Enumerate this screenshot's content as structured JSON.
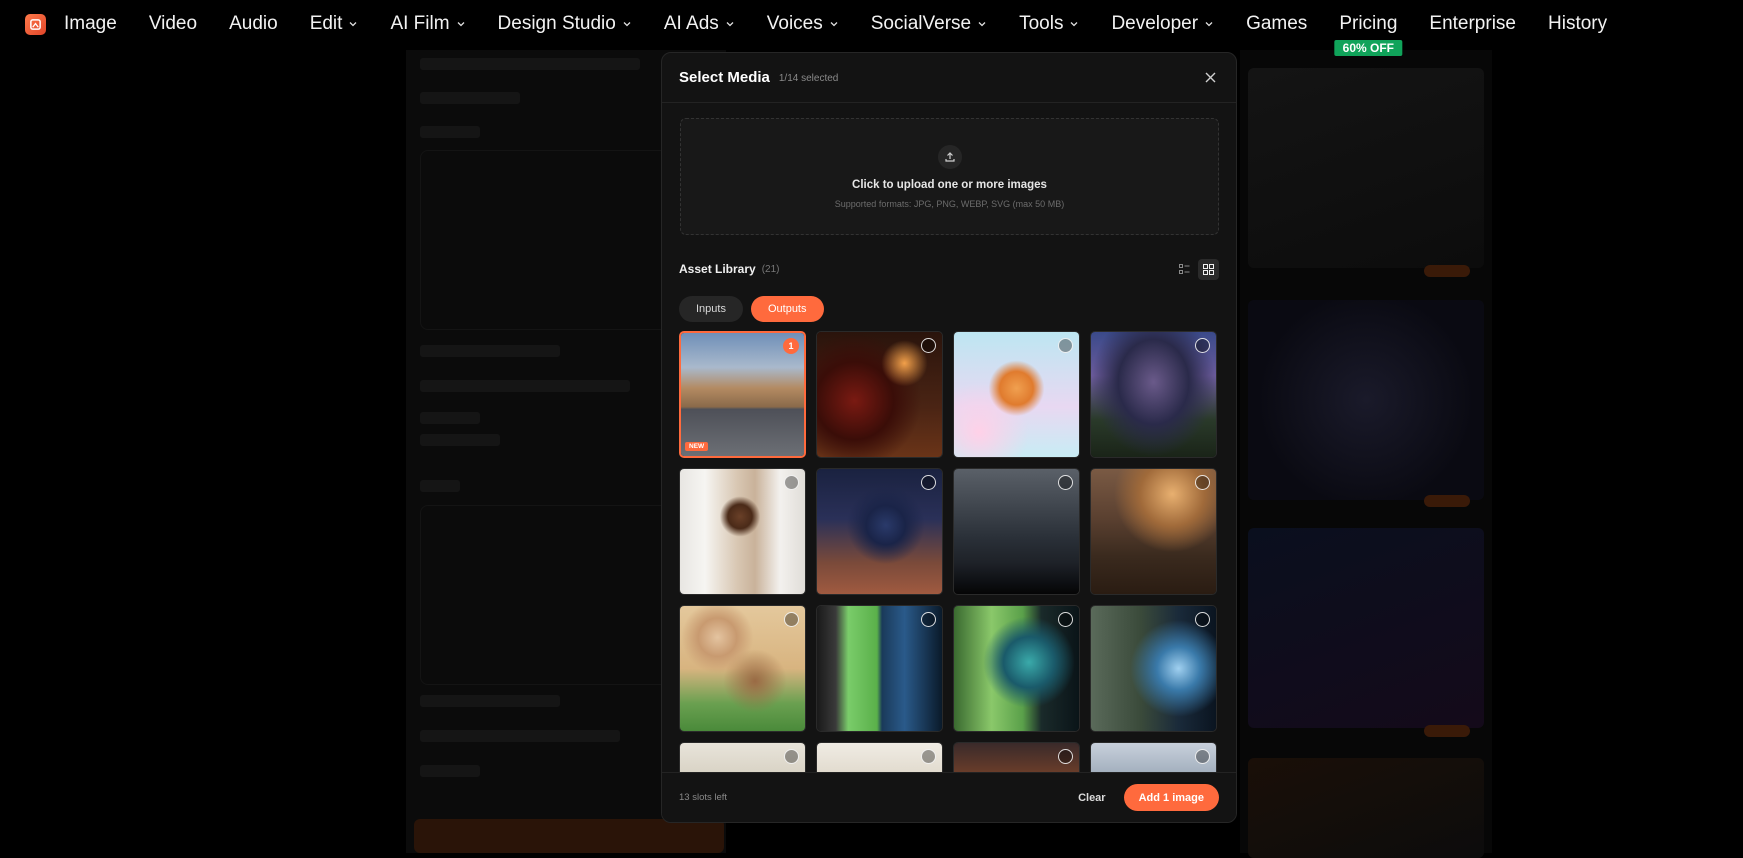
{
  "nav": {
    "items": [
      {
        "label": "Image",
        "dropdown": false
      },
      {
        "label": "Video",
        "dropdown": false
      },
      {
        "label": "Audio",
        "dropdown": false
      },
      {
        "label": "Edit",
        "dropdown": true
      },
      {
        "label": "AI Film",
        "dropdown": true
      },
      {
        "label": "Design Studio",
        "dropdown": true
      },
      {
        "label": "AI Ads",
        "dropdown": true
      },
      {
        "label": "Voices",
        "dropdown": true
      },
      {
        "label": "SocialVerse",
        "dropdown": true
      },
      {
        "label": "Tools",
        "dropdown": true
      },
      {
        "label": "Developer",
        "dropdown": true
      },
      {
        "label": "Games",
        "dropdown": false
      },
      {
        "label": "Pricing",
        "dropdown": false,
        "badge": "60% OFF"
      },
      {
        "label": "Enterprise",
        "dropdown": false
      },
      {
        "label": "History",
        "dropdown": false
      }
    ]
  },
  "modal": {
    "title": "Select Media",
    "selected_count": "1/14 selected",
    "upload": {
      "title": "Click to upload one or more images",
      "subtitle": "Supported formats: JPG, PNG, WEBP, SVG (max 50 MB)"
    },
    "library": {
      "title": "Asset Library",
      "count": "(21)"
    },
    "tabs": [
      {
        "label": "Inputs",
        "active": false
      },
      {
        "label": "Outputs",
        "active": true
      }
    ],
    "tiles": [
      {
        "art": "car-suv",
        "selected": true,
        "order": "1",
        "badge": "NEW"
      },
      {
        "art": "wine-candles",
        "selected": false
      },
      {
        "art": "cartoon-aviator-cat",
        "selected": false
      },
      {
        "art": "futuristic-pavilion",
        "selected": false
      },
      {
        "art": "woman-laptop-office",
        "selected": false
      },
      {
        "art": "basketball-dunk",
        "selected": false
      },
      {
        "art": "dark-mountains",
        "selected": false
      },
      {
        "art": "castle-valley-sunset",
        "selected": false
      },
      {
        "art": "felt-bear-explorer",
        "selected": false
      },
      {
        "art": "greenscreen-split",
        "selected": false
      },
      {
        "art": "greenscreen-portal",
        "selected": false
      },
      {
        "art": "camera-rig-vfx",
        "selected": false
      },
      {
        "art": "balcony-railing",
        "selected": false
      },
      {
        "art": "sunset-figure",
        "selected": false
      },
      {
        "art": "dusk-landscape",
        "selected": false
      },
      {
        "art": "city-skyline",
        "selected": false
      }
    ],
    "footer": {
      "slots_left": "13 slots left",
      "clear_label": "Clear",
      "add_label": "Add 1 image"
    }
  },
  "colors": {
    "accent": "#ff6a3d",
    "badge_green": "#10a35a",
    "modal_bg": "#131313"
  }
}
